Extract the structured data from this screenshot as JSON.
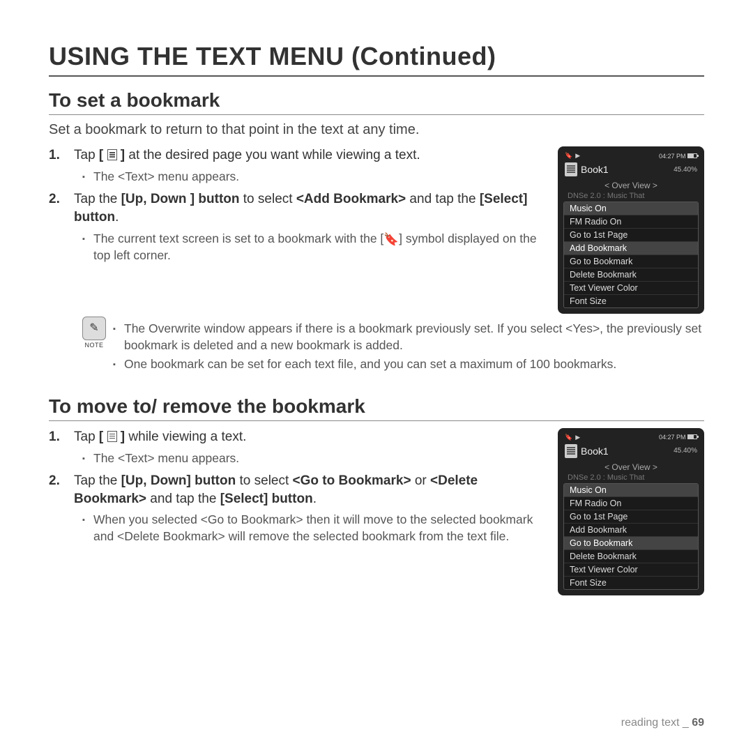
{
  "page_title": "USING THE TEXT MENU (Continued)",
  "section1": {
    "title": "To set a bookmark",
    "intro": "Set a bookmark to return to that point in the text at any time.",
    "step1_a": "Tap ",
    "step1_glyph_prefix": "[ ",
    "step1_glyph_suffix": " ]",
    "step1_b": " at the desired page you want while viewing a text.",
    "sub1_1": "The <Text> menu appears.",
    "step2_a": "Tap the ",
    "step2_b": "[Up, Down ] button",
    "step2_c": " to select ",
    "step2_d": "<Add Bookmark>",
    "step2_e": " and tap the ",
    "step2_f": "[Select] button",
    "step2_g": ".",
    "sub2_1_a": "The current text screen is set to a bookmark with the [",
    "sub2_1_b": "] symbol displayed on the top left corner.",
    "note_label": "NOTE",
    "note1": "The Overwrite window appears if there is a bookmark previously set. If you select <Yes>, the previously set bookmark is deleted and a new bookmark is added.",
    "note2": "One bookmark can be set for each text file, and you can set a maximum of 100 bookmarks."
  },
  "section2": {
    "title": "To move to/ remove the bookmark",
    "step1_a": "Tap ",
    "step1_glyph_prefix": "[ ",
    "step1_glyph_suffix": " ]",
    "step1_b": " while viewing a text.",
    "sub1_1": "The <Text> menu appears.",
    "step2_a": "Tap the ",
    "step2_b": "[Up, Down] button",
    "step2_c": " to select ",
    "step2_d": "<Go to Bookmark>",
    "step2_e": " or ",
    "step2_f": "<Delete Bookmark>",
    "step2_g": " and tap the ",
    "step2_h": "[Select] button",
    "step2_i": ".",
    "sub2_1": "When you selected <Go to Bookmark> then it will move to the selected bookmark and <Delete Bookmark> will remove the selected bookmark from the text file."
  },
  "device1": {
    "time": "04:27 PM",
    "title": "Book1",
    "pct": "45.40%",
    "overview": "< Over View >",
    "faint": "DNSe 2.0 : Music That",
    "items": [
      "Music On",
      "FM Radio On",
      "Go to 1st Page",
      "Add Bookmark",
      "Go to Bookmark",
      "Delete Bookmark",
      "Text Viewer Color",
      "Font Size"
    ],
    "selected": [
      0,
      3
    ]
  },
  "device2": {
    "time": "04:27 PM",
    "title": "Book1",
    "pct": "45.40%",
    "overview": "< Over View >",
    "faint": "DNSe 2.0 : Music That",
    "items": [
      "Music On",
      "FM Radio On",
      "Go to 1st Page",
      "Add Bookmark",
      "Go to Bookmark",
      "Delete Bookmark",
      "Text Viewer Color",
      "Font Size"
    ],
    "selected": [
      0,
      4
    ]
  },
  "footer": {
    "section": "reading text",
    "sep": " _ ",
    "page": "69"
  }
}
